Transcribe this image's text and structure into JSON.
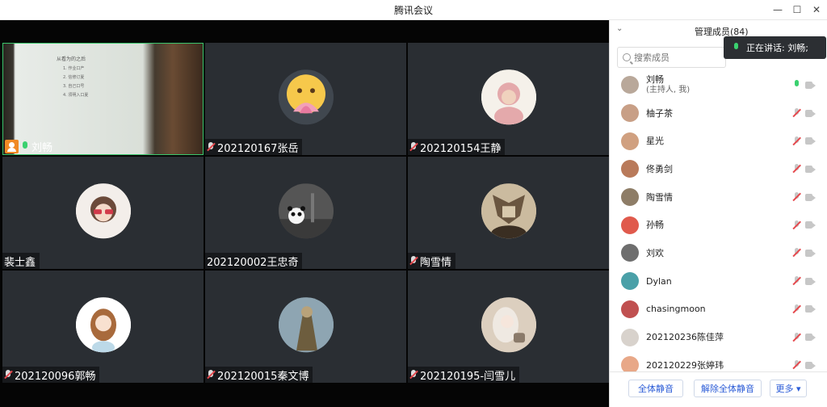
{
  "window": {
    "title": "腾讯会议",
    "minimize": "—",
    "maximize": "☐",
    "close": "✕"
  },
  "tiles": [
    {
      "name": "刘畅",
      "host": true,
      "mic": "on",
      "screen": true,
      "screen_title": "从看为的之后",
      "screen_lines": [
        "1. 作业口产",
        "2. 信修订夏",
        "3. 自己口号",
        "4. 须明入口夏"
      ]
    },
    {
      "name": "202120167张岳",
      "mic": "muted",
      "avatar_color": "#f2c75a"
    },
    {
      "name": "202120154王静",
      "mic": "muted",
      "avatar_color": "#e9b7b9"
    },
    {
      "name": "裴士鑫",
      "mic": "none",
      "avatar_color": "#ead7d2"
    },
    {
      "name": "202120002王忠奇",
      "mic": "none",
      "avatar_color": "#4a4a4a"
    },
    {
      "name": "陶雪情",
      "mic": "muted",
      "avatar_color": "#9b8b73"
    },
    {
      "name": "202120096郭畅",
      "mic": "muted",
      "avatar_color": "#f1e6d9"
    },
    {
      "name": "202120015秦文博",
      "mic": "muted",
      "avatar_color": "#8fa7b5"
    },
    {
      "name": "202120195-闫雪儿",
      "mic": "muted",
      "avatar_color": "#d9cbbb"
    }
  ],
  "panel": {
    "header": "管理成员(84)",
    "speaking": "正在讲话: 刘畅;",
    "search_placeholder": "搜索成员",
    "members": [
      {
        "name": "刘畅",
        "sub": "(主持人, 我)",
        "mic": "on",
        "color": "#b9a89a"
      },
      {
        "name": "柚子茶",
        "sub": "",
        "mic": "muted",
        "color": "#c89f86"
      },
      {
        "name": "星光",
        "sub": "",
        "mic": "muted",
        "color": "#d0a080"
      },
      {
        "name": "佟勇剑",
        "sub": "",
        "mic": "muted",
        "color": "#b97a5a"
      },
      {
        "name": "陶雪情",
        "sub": "",
        "mic": "muted",
        "color": "#8e7d67"
      },
      {
        "name": "孙畅",
        "sub": "",
        "mic": "muted",
        "color": "#e05a4c"
      },
      {
        "name": "刘欢",
        "sub": "",
        "mic": "muted",
        "color": "#6e6e6e"
      },
      {
        "name": "Dylan",
        "sub": "",
        "mic": "muted",
        "color": "#4aa0a8"
      },
      {
        "name": "chasingmoon",
        "sub": "",
        "mic": "muted",
        "color": "#c05050"
      },
      {
        "name": "202120236陈佳萍",
        "sub": "",
        "mic": "muted",
        "color": "#d8d2cc"
      },
      {
        "name": "202120229张婷玮",
        "sub": "",
        "mic": "muted",
        "color": "#e8a888"
      }
    ],
    "footer": {
      "mute_all": "全体静音",
      "unmute_all": "解除全体静音",
      "more": "更多 ▾"
    }
  }
}
